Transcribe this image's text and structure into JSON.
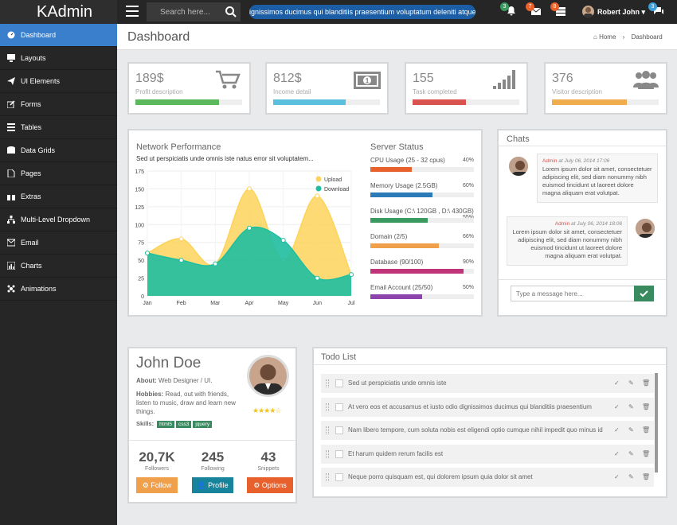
{
  "brand": "KAdmin",
  "search": {
    "placeholder": "Search here..."
  },
  "ticker": "ignissimos ducimus qui blanditiis praesentium voluptatum deleniti atque.",
  "notifications": [
    {
      "icon": "bell-icon",
      "count": "3",
      "color": "#3a9a5f"
    },
    {
      "icon": "envelope-icon",
      "count": "7",
      "color": "#e8612c"
    },
    {
      "icon": "tasks-icon",
      "count": "8",
      "color": "#e8612c"
    },
    {
      "icon": "chat-icon",
      "count": "3",
      "color": "#3aa0d8"
    }
  ],
  "user": {
    "name": "Robert John"
  },
  "sidebar": {
    "items": [
      {
        "label": "Dashboard",
        "icon": "dashboard-icon"
      },
      {
        "label": "Layouts",
        "icon": "desktop-icon"
      },
      {
        "label": "UI Elements",
        "icon": "paper-plane-icon"
      },
      {
        "label": "Forms",
        "icon": "edit-icon"
      },
      {
        "label": "Tables",
        "icon": "list-icon"
      },
      {
        "label": "Data Grids",
        "icon": "database-icon"
      },
      {
        "label": "Pages",
        "icon": "file-icon"
      },
      {
        "label": "Extras",
        "icon": "gift-icon"
      },
      {
        "label": "Multi-Level Dropdown",
        "icon": "sitemap-icon"
      },
      {
        "label": "Email",
        "icon": "envelope-icon"
      },
      {
        "label": "Charts",
        "icon": "bar-chart-icon"
      },
      {
        "label": "Animations",
        "icon": "slack-icon"
      }
    ]
  },
  "header": {
    "title": "Dashboard",
    "breadcrumb": {
      "home": "Home",
      "sep": "›",
      "current": "Dashboard"
    }
  },
  "stats": [
    {
      "value": "189$",
      "label": "Profit description",
      "progress": 0.78,
      "color": "#5cb85c",
      "icon": "cart-icon"
    },
    {
      "value": "812$",
      "label": "Income detail",
      "progress": 0.68,
      "color": "#5bc0de",
      "icon": "money-icon"
    },
    {
      "value": "155",
      "label": "Task completed",
      "progress": 0.5,
      "color": "#d9534f",
      "icon": "signal-icon"
    },
    {
      "value": "376",
      "label": "Visitor description",
      "progress": 0.7,
      "color": "#f0ad4e",
      "icon": "group-icon"
    }
  ],
  "network": {
    "title": "Network Performance",
    "subtitle": "Sed ut perspiciatis unde omnis iste natus error sit voluptatem..."
  },
  "chart_data": {
    "type": "area",
    "categories": [
      "Jan",
      "Feb",
      "Mar",
      "Apr",
      "May",
      "Jun",
      "Jul"
    ],
    "ylim": [
      0,
      175
    ],
    "yticks": [
      "175",
      "150",
      "125",
      "100",
      "75",
      "50",
      "25",
      "0"
    ],
    "series": [
      {
        "name": "Upload",
        "color": "#fdd35a",
        "values": [
          60,
          80,
          45,
          150,
          50,
          140,
          30
        ]
      },
      {
        "name": "Download",
        "color": "#1fbea1",
        "values": [
          60,
          50,
          45,
          95,
          78,
          25,
          30
        ]
      }
    ],
    "legend": "top-right",
    "grid": true
  },
  "server": {
    "title": "Server Status",
    "items": [
      {
        "label": "CPU Usage (25 - 32 cpus)",
        "pct": "40%",
        "value": 0.4,
        "color": "#e8612c"
      },
      {
        "label": "Memory Usage (2.5GB)",
        "pct": "60%",
        "value": 0.6,
        "color": "#2b7bb9"
      },
      {
        "label": "Disk Usage (C:\\ 120GB , D:\\ 430GB)",
        "pct": "55%",
        "value": 0.55,
        "color": "#3a9a5f"
      },
      {
        "label": "Domain (2/5)",
        "pct": "66%",
        "value": 0.66,
        "color": "#f0a04b"
      },
      {
        "label": "Database (90/100)",
        "pct": "90%",
        "value": 0.9,
        "color": "#c0357a"
      },
      {
        "label": "Email Account (25/50)",
        "pct": "50%",
        "value": 0.5,
        "color": "#8e44ad"
      }
    ]
  },
  "chats": {
    "title": "Chats",
    "messages": [
      {
        "author": "Admin",
        "meta": " at July 06, 2014 17:06",
        "text": "Lorem ipsum dolor sit amet, consectetuer adipiscing elit, sed diam nonummy nibh euismod tincidunt ut laoreet dolore magna aliquam erat volutpat."
      },
      {
        "author": "Admin",
        "meta": " at July 06, 2014 18:06",
        "text": "Lorem ipsum dolor sit amet, consectetuer adipiscing elit, sed diam nonummy nibh euismod tincidunt ut laoreet dolore magna aliquam erat volutpat."
      }
    ],
    "input_placeholder": "Type a message here..."
  },
  "profile": {
    "name": "John Doe",
    "about_label": "About:",
    "about": " Web Designer / UI.",
    "hobbies_label": "Hobbies:",
    "hobbies": " Read, out with friends, listen to music, draw and learn new things.",
    "rating": 4,
    "rating_max": 5,
    "skills_label": "Skills:",
    "skills": [
      "html5",
      "css3",
      "jquery"
    ],
    "followers": "20,7K",
    "followers_label": "Followers",
    "following": "245",
    "following_label": "Following",
    "snippets": "43",
    "snippets_label": "Snippets",
    "buttons": {
      "follow": "Follow",
      "profile": "Profile",
      "options": "Options"
    }
  },
  "todo": {
    "title": "Todo List",
    "items": [
      "Sed ut perspiciatis unde omnis iste",
      "At vero eos et accusamus et iusto odio dignissimos ducimus qui blanditiis praesentium",
      "Nam libero tempore, cum soluta nobis est eligendi optio cumque nihil impedit quo minus id",
      "Et harum quidem rerum facilis est",
      "Neque porro quisquam est, qui dolorem ipsum quia dolor sit amet"
    ]
  }
}
